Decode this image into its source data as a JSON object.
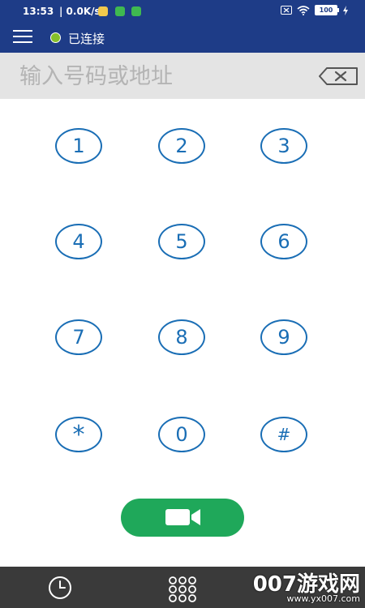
{
  "status_bar": {
    "time": "13:53",
    "network_speed": "| 0.0K/s",
    "battery": "100"
  },
  "app_bar": {
    "connection_status": "已连接",
    "connection_color": "#86c02a"
  },
  "input": {
    "placeholder": "输入号码或地址",
    "value": ""
  },
  "keypad": {
    "keys": [
      "1",
      "2",
      "3",
      "4",
      "5",
      "6",
      "7",
      "8",
      "9",
      "*",
      "0",
      "#"
    ]
  },
  "colors": {
    "primary": "#1e3c87",
    "key_outline": "#1a6eb5",
    "call_button": "#1fa85a",
    "nav_background": "#3a3a3a"
  },
  "icons": {
    "menu": "menu-icon",
    "backspace": "backspace-icon",
    "video_call": "video-camera-icon",
    "history": "clock-icon",
    "dialpad": "dialpad-icon"
  },
  "watermark": {
    "text": "007游戏网",
    "url": "www.yx007.com"
  }
}
